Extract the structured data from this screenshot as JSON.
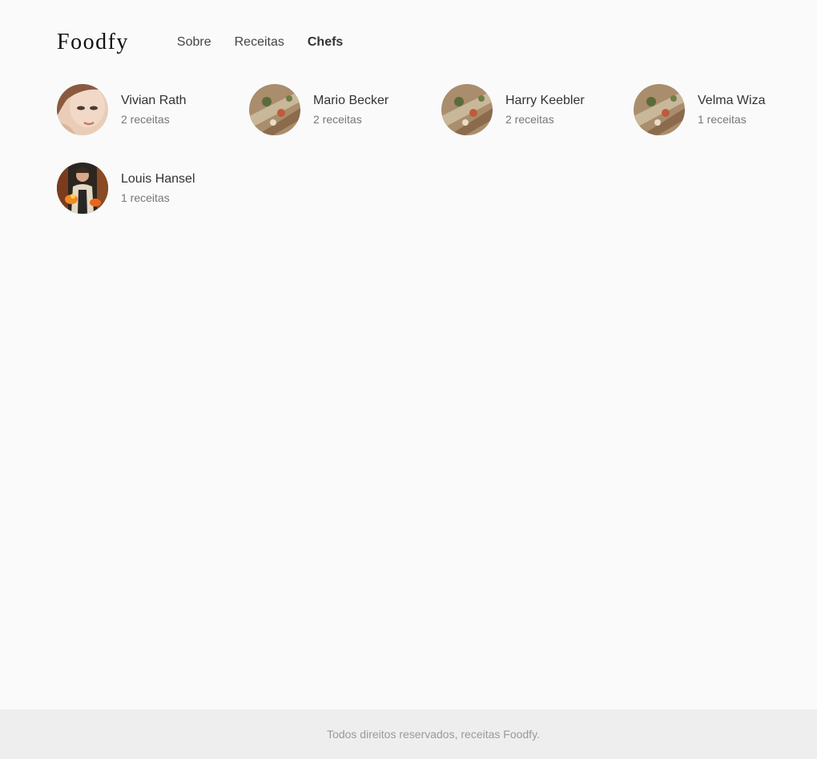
{
  "header": {
    "logo": "Foodfy",
    "nav": [
      {
        "label": "Sobre",
        "active": false
      },
      {
        "label": "Receitas",
        "active": false
      },
      {
        "label": "Chefs",
        "active": true
      }
    ]
  },
  "chefs": [
    {
      "name": "Vivian Rath",
      "count": "2 receitas",
      "photo": "woman-portrait"
    },
    {
      "name": "Mario Becker",
      "count": "2 receitas",
      "photo": "food-dish"
    },
    {
      "name": "Harry Keebler",
      "count": "2 receitas",
      "photo": "food-dish"
    },
    {
      "name": "Velma Wiza",
      "count": "1 receitas",
      "photo": "food-dish"
    },
    {
      "name": "Louis Hansel",
      "count": "1 receitas",
      "photo": "chef-cooking"
    }
  ],
  "footer": {
    "text": "Todos direitos reservados, receitas Foodfy."
  },
  "colors": {
    "background": "#fafafa",
    "footer_background": "#eeeeee",
    "text": "#333333",
    "muted": "#777777"
  }
}
